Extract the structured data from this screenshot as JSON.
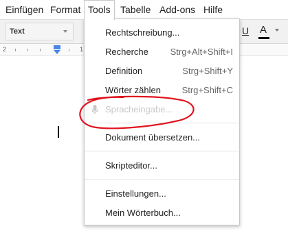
{
  "menubar": {
    "items": [
      "Einfügen",
      "Format",
      "Tools",
      "Tabelle",
      "Add-ons",
      "Hilfe"
    ],
    "active": "Tools"
  },
  "toolbar": {
    "style_value": "Text",
    "underline_label": "U",
    "text_color_label": "A"
  },
  "ruler": {
    "numbers": [
      "2",
      "1"
    ]
  },
  "tools_menu": {
    "items": [
      {
        "label": "Rechtschreibung...",
        "shortcut": ""
      },
      {
        "label": "Recherche",
        "shortcut": "Strg+Alt+Shift+I"
      },
      {
        "label": "Definition",
        "shortcut": "Strg+Shift+Y"
      },
      {
        "label": "Wörter zählen",
        "shortcut": "Strg+Shift+C"
      },
      {
        "label": "Spracheingabe...",
        "shortcut": "",
        "disabled": true
      },
      {
        "label": "Dokument übersetzen..."
      },
      {
        "label": "Skripteditor..."
      },
      {
        "label": "Einstellungen..."
      },
      {
        "label": "Mein Wörterbuch..."
      }
    ]
  },
  "colors": {
    "annotation": "#e0141e",
    "ruler_indent": "#4a86e8",
    "disabled_text": "#c8c8c8"
  },
  "icons": {
    "voice_typing": "microphone-icon"
  }
}
